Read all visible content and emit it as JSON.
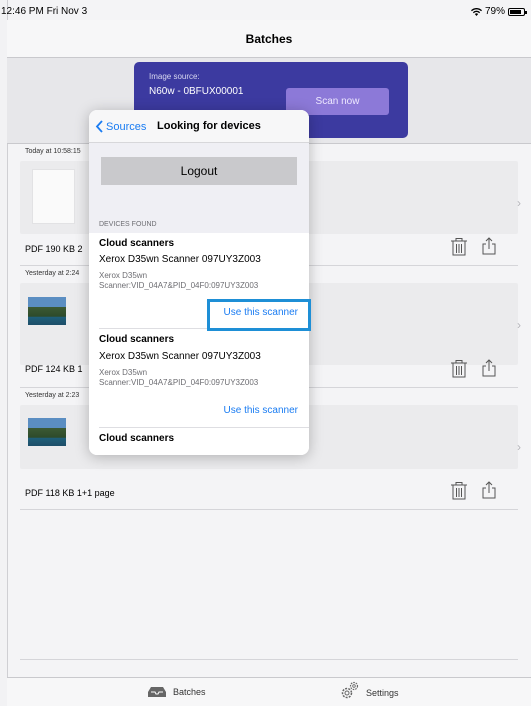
{
  "status_bar": {
    "time": "12:46 PM  Fri Nov 3",
    "battery": "79%"
  },
  "nav": {
    "title": "Batches"
  },
  "banner": {
    "label": "Image source:",
    "value": "N60w - 0BFUX00001",
    "scan_label": "Scan now"
  },
  "batches": [
    {
      "date": "Today at 10:58:15",
      "meta": "PDF  190 KB  2",
      "thumb": "document"
    },
    {
      "date": "Yesterday at 2:24",
      "meta": "PDF  124 KB  1",
      "thumb": "photo"
    },
    {
      "date": "Yesterday at 2:23",
      "meta": "PDF  118 KB  1+1 page",
      "thumb": "photo"
    }
  ],
  "popover": {
    "back_label": "Sources",
    "title": "Looking for devices",
    "logout_label": "Logout",
    "section_label": "DEVICES FOUND",
    "devices": [
      {
        "group": "Cloud scanners",
        "name": "Xerox D35wn Scanner 097UY3Z003",
        "detail": "Xerox D35wn Scanner:VID_04A7&PID_04F0:097UY3Z003",
        "action": "Use this scanner"
      },
      {
        "group": "Cloud scanners",
        "name": "Xerox D35wn Scanner 097UY3Z003",
        "detail": "Xerox D35wn Scanner:VID_04A7&PID_04F0:097UY3Z003",
        "action": "Use this scanner"
      },
      {
        "group": "Cloud scanners"
      }
    ]
  },
  "tabbar": {
    "batches_label": "Batches",
    "settings_label": "Settings"
  },
  "colors": {
    "accent": "#1a7cf2",
    "banner": "#3c3aa0",
    "scan_button": "#8c79d8",
    "highlight": "#1e8fd6"
  }
}
